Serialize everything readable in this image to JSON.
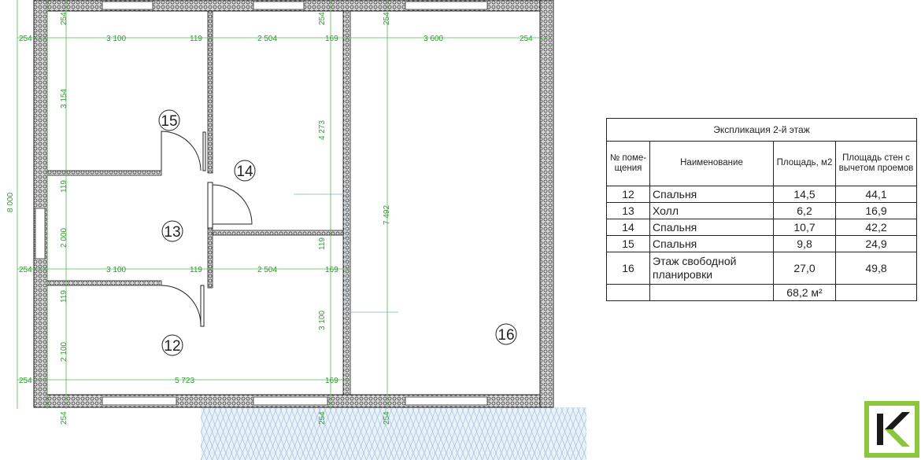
{
  "plan": {
    "dims_h": {
      "top": [
        {
          "id": "t1",
          "text": "254"
        },
        {
          "id": "t2",
          "text": "3 100"
        },
        {
          "id": "t3",
          "text": "119"
        },
        {
          "id": "t4",
          "text": "2 504"
        },
        {
          "id": "t5",
          "text": "169"
        },
        {
          "id": "t6",
          "text": "3 600"
        },
        {
          "id": "t7",
          "text": "254"
        }
      ],
      "middle": [
        {
          "id": "m1",
          "text": "254"
        },
        {
          "id": "m2",
          "text": "3 100"
        },
        {
          "id": "m3",
          "text": "119"
        },
        {
          "id": "m4",
          "text": "2 504"
        },
        {
          "id": "m5",
          "text": "169"
        }
      ],
      "bottom": [
        {
          "id": "b1",
          "text": "254"
        },
        {
          "id": "b2",
          "text": "5 723"
        },
        {
          "id": "b3",
          "text": "169"
        }
      ]
    },
    "dims_v": [
      {
        "id": "v_total",
        "text": "8 000"
      },
      {
        "id": "v_a1",
        "text": "254"
      },
      {
        "id": "v_a2",
        "text": "3 154"
      },
      {
        "id": "v_a3",
        "text": "119"
      },
      {
        "id": "v_a4",
        "text": "2 000"
      },
      {
        "id": "v_a5",
        "text": "119"
      },
      {
        "id": "v_a6",
        "text": "2 100"
      },
      {
        "id": "v_a7",
        "text": "254"
      },
      {
        "id": "v_b1",
        "text": "254"
      },
      {
        "id": "v_b2",
        "text": "4 273"
      },
      {
        "id": "v_b3",
        "text": "119"
      },
      {
        "id": "v_b4",
        "text": "3 100"
      },
      {
        "id": "v_b5",
        "text": "254"
      },
      {
        "id": "v_c1",
        "text": "254"
      },
      {
        "id": "v_c2",
        "text": "7 492"
      },
      {
        "id": "v_c3",
        "text": "254"
      }
    ],
    "rooms": [
      {
        "id": "15",
        "label": "15"
      },
      {
        "id": "14",
        "label": "14"
      },
      {
        "id": "13",
        "label": "13"
      },
      {
        "id": "12",
        "label": "12"
      },
      {
        "id": "16",
        "label": "16"
      }
    ]
  },
  "explication": {
    "title": "Экспликация 2-й этаж",
    "headers": {
      "num": "№ поме-щения",
      "name": "Наименование",
      "area": "Площадь, м2",
      "wall_area": "Площадь стен с вычетом проемов"
    },
    "rows": [
      {
        "num": "12",
        "name": "Спальня",
        "area": "14,5",
        "wall_area": "44,1"
      },
      {
        "num": "13",
        "name": "Холл",
        "area": "6,2",
        "wall_area": "16,9"
      },
      {
        "num": "14",
        "name": "Спальня",
        "area": "10,7",
        "wall_area": "42,2"
      },
      {
        "num": "15",
        "name": "Спальня",
        "area": "9,8",
        "wall_area": "24,9"
      },
      {
        "num": "16",
        "name": "Этаж свободной планировки",
        "area": "27,0",
        "wall_area": "49,8"
      }
    ],
    "total": {
      "num": "",
      "name": "",
      "area": "68,2 м²",
      "wall_area": ""
    }
  },
  "colors": {
    "dimension": "#2ca02c",
    "wall_fill": "#cfcfcf",
    "wall_hatch": "#444444",
    "balcony": "#c8dcf0",
    "logo_green": "#8cc63f"
  },
  "icons": {
    "logo": "k-logo-icon"
  }
}
